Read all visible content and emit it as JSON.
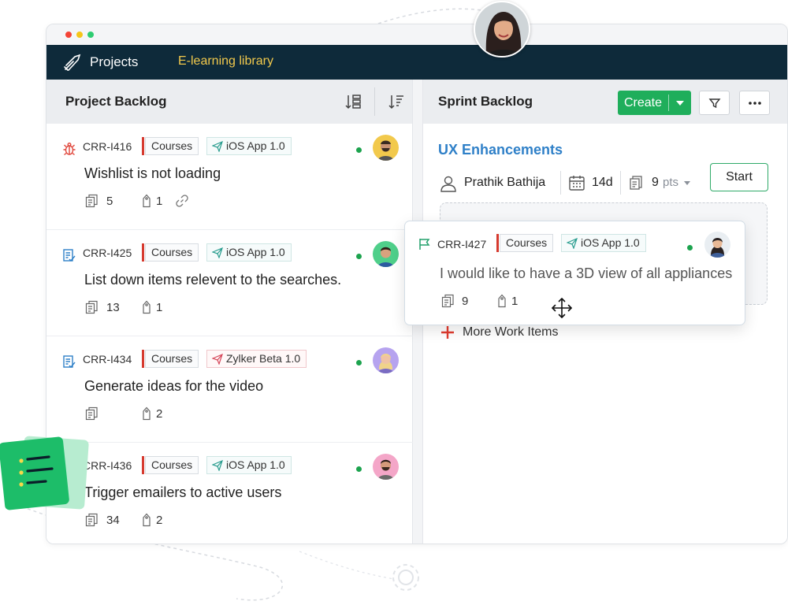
{
  "navbar": {
    "title": "Projects",
    "link": "E-learning library"
  },
  "project_backlog": {
    "title": "Project Backlog",
    "items": [
      {
        "id": "CRR-I416",
        "type_icon": "bug-icon",
        "tag": "Courses",
        "release": "iOS App 1.0",
        "title": "Wishlist is not loading",
        "subitems": "5",
        "attachments": "1",
        "has_link": true
      },
      {
        "id": "CRR-I425",
        "type_icon": "story-icon",
        "tag": "Courses",
        "release": "iOS App 1.0",
        "title": "List down items relevent to the searches.",
        "subitems": "13",
        "attachments": "1"
      },
      {
        "id": "CRR-I434",
        "type_icon": "story-icon",
        "tag": "Courses",
        "release": "Zylker Beta 1.0",
        "title": "Generate ideas for the video",
        "subitems": "",
        "attachments": "2"
      },
      {
        "id": "CRR-I436",
        "type_icon": "flag-icon",
        "tag": "Courses",
        "release": "iOS App 1.0",
        "title": "Trigger emailers to active users",
        "subitems": "34",
        "attachments": "2"
      }
    ]
  },
  "sprint_backlog": {
    "title": "Sprint Backlog",
    "create_label": "Create",
    "sprint_name": "UX Enhancements",
    "owner": "Prathik Bathija",
    "duration": "14d",
    "points_value": "9",
    "points_unit": "pts",
    "start_label": "Start",
    "more_label": "More Work Items"
  },
  "dragged_item": {
    "id": "CRR-I427",
    "tag": "Courses",
    "release": "iOS App 1.0",
    "title": "I would like to have a 3D view of all appliances",
    "subitems": "9",
    "attachments": "1"
  },
  "colors": {
    "navbar_bg": "#0e2a3a",
    "link_yellow": "#f2c94c",
    "create_green": "#1fae5b",
    "sprint_blue": "#2f80c8",
    "tag_red": "#d63a2f"
  }
}
